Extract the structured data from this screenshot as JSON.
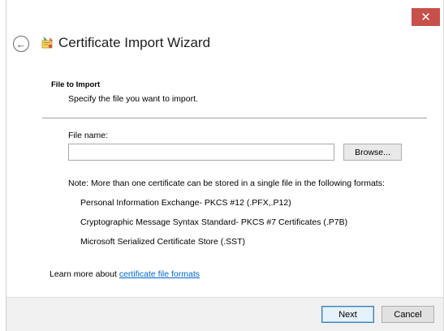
{
  "window": {
    "title": "Certificate Import Wizard",
    "close_glyph": "✕",
    "back_glyph": "←"
  },
  "section": {
    "heading": "File to Import",
    "subtitle": "Specify the file you want to import."
  },
  "file_field": {
    "label": "File name:",
    "value": "",
    "placeholder": "",
    "browse_label": "Browse..."
  },
  "note": "Note:  More than one certificate can be stored in a single file in the following formats:",
  "formats": [
    "Personal Information Exchange- PKCS #12 (.PFX,.P12)",
    "Cryptographic Message Syntax Standard- PKCS #7 Certificates (.P7B)",
    "Microsoft Serialized Certificate Store (.SST)"
  ],
  "learn_more": {
    "prefix": "Learn more about ",
    "link_text": "certificate file formats"
  },
  "footer": {
    "next_label": "Next",
    "cancel_label": "Cancel"
  },
  "colors": {
    "close_button": "#c7504b",
    "link": "#0066cc",
    "footer_bg": "#f0f0f0",
    "next_border": "#3c7fb1"
  },
  "icons": {
    "back": "back-arrow-icon",
    "wizard": "certificate-wizard-icon",
    "close": "close-icon"
  }
}
